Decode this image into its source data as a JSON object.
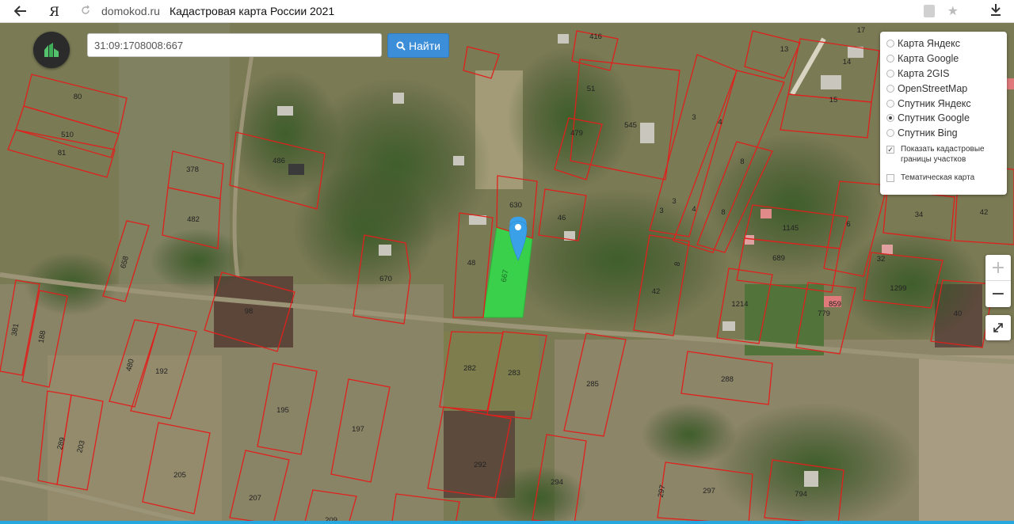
{
  "browser": {
    "back_icon": "arrow-left-icon",
    "engine_logo": "Я",
    "domain": "domokod.ru",
    "title": "Кадастровая карта России 2021"
  },
  "search": {
    "value": "31:09:1708008:667",
    "button_label": "Найти"
  },
  "layers": {
    "items": [
      {
        "label": "Карта Яндекс",
        "selected": false
      },
      {
        "label": "Карта Google",
        "selected": false
      },
      {
        "label": "Карта 2GIS",
        "selected": false
      },
      {
        "label": "OpenStreetMap",
        "selected": false
      },
      {
        "label": "Спутник Яндекс",
        "selected": false
      },
      {
        "label": "Спутник Google",
        "selected": true
      },
      {
        "label": "Спутник Bing",
        "selected": false
      }
    ],
    "show_boundaries_label": "Показать кадастровые границы участков",
    "show_boundaries_checked": true,
    "thematic_label": "Тематическая карта",
    "thematic_checked": false
  },
  "zoom": {
    "in": "+",
    "out": "−"
  },
  "highlighted_parcel": "667",
  "parcel_numbers": [
    "416",
    "17",
    "13",
    "14",
    "15",
    "51",
    "545",
    "479",
    "3",
    "4",
    "8",
    "80",
    "510",
    "81",
    "486",
    "378",
    "482",
    "658",
    "630",
    "46",
    "1145",
    "689",
    "6",
    "34",
    "42",
    "32",
    "1299",
    "48",
    "670",
    "667",
    "98",
    "42",
    "1214",
    "859",
    "779",
    "40",
    "381",
    "188",
    "480",
    "192",
    "282",
    "283",
    "285",
    "288",
    "195",
    "197",
    "292",
    "289",
    "203",
    "205",
    "207",
    "209",
    "294",
    "297",
    "297",
    "794",
    "8",
    "3",
    "3",
    "4",
    "8"
  ],
  "colors": {
    "parcel_border": "#e0201c",
    "highlight_fill": "#2fe04a",
    "search_button": "#3c8ed8"
  }
}
